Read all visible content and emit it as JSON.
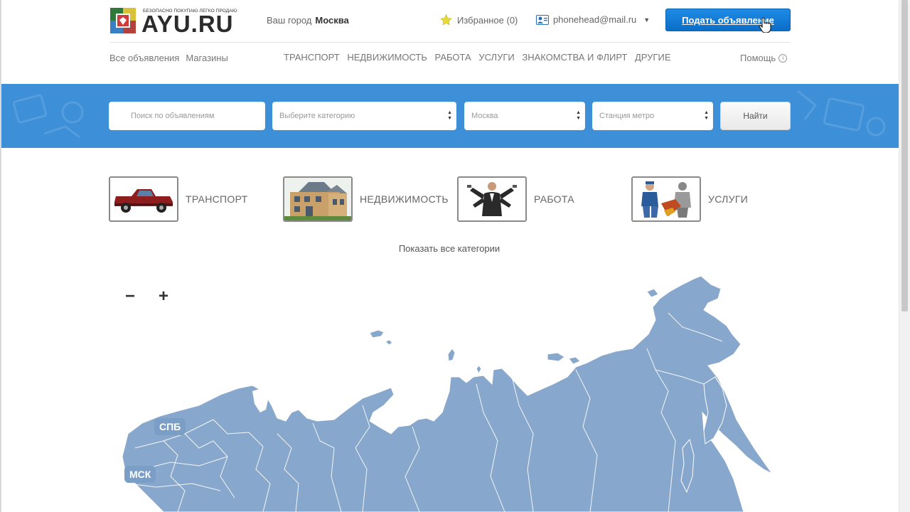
{
  "header": {
    "logo_text": "AYU.RU",
    "logo_tagline": "БЕЗОПАСНО ПОКУПАЮ ЛЕГКО ПРОДАЮ",
    "city_label": "Ваш город",
    "city_value": "Москва",
    "favorites": "Избранное (0)",
    "user_email": "phonehead@mail.ru",
    "post_button": "Подать объявление"
  },
  "subnav": {
    "all_ads": "Все объявления",
    "shops": "Магазины",
    "categories": [
      "ТРАНСПОРТ",
      "НЕДВИЖИМОСТЬ",
      "РАБОТА",
      "УСЛУГИ",
      "ЗНАКОМСТВА И ФЛИРТ",
      "ДРУГИЕ"
    ],
    "help": "Помощь",
    "help_icon": "i"
  },
  "search": {
    "query_placeholder": "Поиск по объявлениям",
    "category_placeholder": "Выберите категорию",
    "city_value": "Москва",
    "metro_placeholder": "Станция метро",
    "find_button": "Найти"
  },
  "categories": [
    {
      "label": "ТРАНСПОРТ",
      "icon": "pickup-truck-photo"
    },
    {
      "label": "НЕДВИЖИМОСТЬ",
      "icon": "house-photo"
    },
    {
      "label": "РАБОТА",
      "icon": "businessman-photo"
    },
    {
      "label": "УСЛУГИ",
      "icon": "workers-photo"
    }
  ],
  "show_all_categories": "Показать все категории",
  "map": {
    "zoom_out": "−",
    "zoom_in": "+",
    "city_pills": [
      "СПБ",
      "МСК"
    ]
  },
  "colors": {
    "accent_blue": "#3d8fd8",
    "button_blue": "#0b6ec8",
    "map_fill": "#87a7cc",
    "map_pill": "#7b9ec6"
  }
}
